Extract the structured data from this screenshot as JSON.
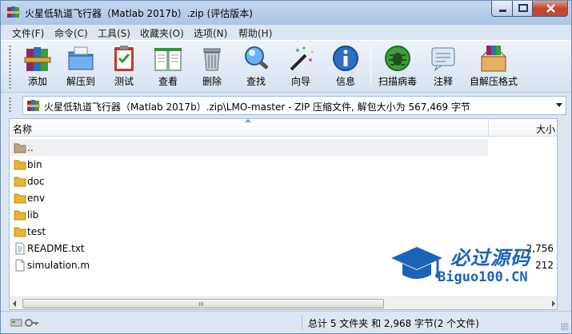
{
  "window": {
    "title": "火星低轨道飞行器（Matlab 2017b）.zip (评估版本)"
  },
  "menu": [
    {
      "label": "文件(F)"
    },
    {
      "label": "命令(C)"
    },
    {
      "label": "工具(S)"
    },
    {
      "label": "收藏夹(O)"
    },
    {
      "label": "选项(N)"
    },
    {
      "label": "帮助(H)"
    }
  ],
  "toolbar": [
    {
      "label": "添加",
      "icon": "books-add-icon"
    },
    {
      "label": "解压到",
      "icon": "folder-extract-icon"
    },
    {
      "label": "测试",
      "icon": "clipboard-test-icon"
    },
    {
      "label": "查看",
      "icon": "book-view-icon"
    },
    {
      "label": "删除",
      "icon": "trash-icon"
    },
    {
      "label": "查找",
      "icon": "magnifier-icon"
    },
    {
      "label": "向导",
      "icon": "wizard-wand-icon"
    },
    {
      "label": "信息",
      "icon": "info-icon"
    },
    {
      "label": "扫描病毒",
      "icon": "bug-scan-icon"
    },
    {
      "label": "注释",
      "icon": "comment-icon"
    },
    {
      "label": "自解压格式",
      "icon": "sfx-box-icon"
    }
  ],
  "address": {
    "path": "火星低轨道飞行器（Matlab 2017b）.zip\\LMO-master - ZIP 压缩文件, 解包大小为 567,469 字节"
  },
  "list": {
    "columns": {
      "name": "名称",
      "size": "大小"
    },
    "rows": [
      {
        "name": "..",
        "type": "parent",
        "size": ""
      },
      {
        "name": "bin",
        "type": "folder",
        "size": ""
      },
      {
        "name": "doc",
        "type": "folder",
        "size": ""
      },
      {
        "name": "env",
        "type": "folder",
        "size": ""
      },
      {
        "name": "lib",
        "type": "folder",
        "size": ""
      },
      {
        "name": "test",
        "type": "folder",
        "size": ""
      },
      {
        "name": "README.txt",
        "type": "file",
        "size": "2,756"
      },
      {
        "name": "simulation.m",
        "type": "file",
        "size": "212"
      }
    ]
  },
  "watermark": {
    "cn": "必过源码",
    "en": "Biguo100.CN"
  },
  "status": {
    "summary": "总计 5 文件夹 和 2,968 字节(2 个文件)"
  },
  "colors": {
    "chrome": "#dbe6f3",
    "folder": "#e8b532",
    "watermark": "#1d63b7"
  }
}
